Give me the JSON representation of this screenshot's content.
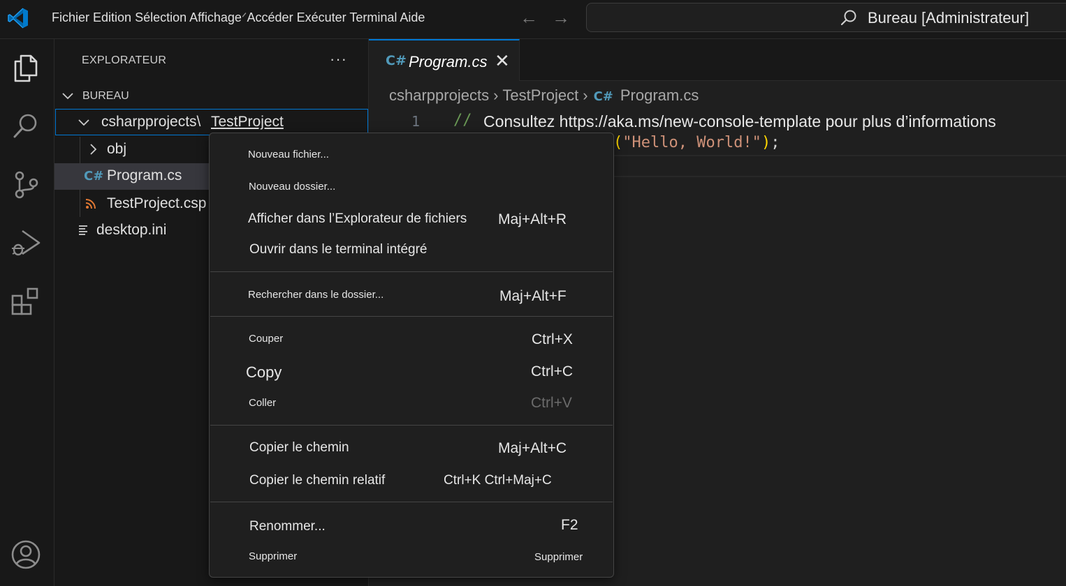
{
  "menubar": {
    "items": [
      "Fichier",
      "Edition",
      "Sélection",
      "Affichage",
      "Accéder",
      "Exécuter",
      "Terminal",
      "Aide"
    ]
  },
  "command_center": {
    "text": "Bureau [Administrateur]"
  },
  "activity_bar": {
    "items": [
      "explorer-icon",
      "search-icon",
      "source-control-icon",
      "run-debug-icon",
      "extensions-icon",
      "account-icon"
    ]
  },
  "sidebar": {
    "title": "EXPLORATEUR",
    "more": "···",
    "workspace": "BUREAU",
    "tree": {
      "folder_prefix": "csharpprojects\\",
      "folder_name": "TestProject",
      "obj": "obj",
      "program": "Program.cs",
      "csproj": "TestProject.csp",
      "desktop_ini": "desktop.ini"
    }
  },
  "editor": {
    "tab_label": "Program.cs",
    "tab_close": "✕",
    "breadcrumb": [
      "csharpprojects",
      "TestProject",
      "Program.cs"
    ],
    "line1_num": "1",
    "line1_comment": "//",
    "line1_text": "Consultez https://aka.ms/new-console-template pour plus d’informations",
    "line2_open": "(",
    "line2_string": "\"Hello, World!\"",
    "line2_close": ")",
    "line2_semi": ";"
  },
  "context_menu": {
    "new_file": "Nouveau fichier...",
    "new_folder": "Nouveau dossier...",
    "reveal": "Afficher dans l’Explorateur de fichiers",
    "reveal_key": "Maj+Alt+R",
    "open_terminal": "Ouvrir dans le terminal intégré",
    "find_in_folder": "Rechercher dans le dossier...",
    "find_key": "Maj+Alt+F",
    "cut": "Couper",
    "cut_key": "Ctrl+X",
    "copy": "Copy",
    "copy_key": "Ctrl+C",
    "paste": "Coller",
    "paste_key": "Ctrl+V",
    "copy_path": "Copier le chemin",
    "copy_path_key": "Maj+Alt+C",
    "copy_rel_path": "Copier le chemin relatif",
    "copy_rel_path_key": "Ctrl+K Ctrl+Maj+C",
    "rename": "Renommer...",
    "rename_key": "F2",
    "delete": "Supprimer",
    "delete_key": "Supprimer"
  }
}
